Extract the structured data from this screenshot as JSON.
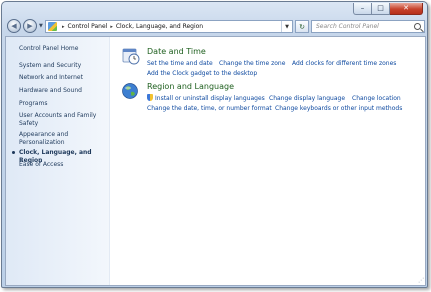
{
  "window": {
    "caption": {
      "minimize": "–",
      "maximize": "□",
      "close": "✕"
    }
  },
  "nav": {
    "back_glyph": "◀",
    "forward_glyph": "▶",
    "dropdown_glyph": "▼",
    "refresh_glyph": "↻"
  },
  "address": {
    "root_glyph": "▸",
    "crumbs": [
      "Control Panel",
      "Clock, Language, and Region"
    ],
    "separator": "▸",
    "dropdown_glyph": "▼"
  },
  "search": {
    "placeholder": "Search Control Panel"
  },
  "sidebar": {
    "home": "Control Panel Home",
    "items": [
      {
        "label": "System and Security"
      },
      {
        "label": "Network and Internet"
      },
      {
        "label": "Hardware and Sound"
      },
      {
        "label": "Programs"
      },
      {
        "label": "User Accounts and Family Safety"
      },
      {
        "label": "Appearance and Personalization"
      },
      {
        "label": "Clock, Language, and Region",
        "current": true
      },
      {
        "label": "Ease of Access"
      }
    ]
  },
  "categories": [
    {
      "title": "Date and Time",
      "icon": "clock-calendar-icon",
      "links": [
        "Set the time and date",
        "Change the time zone",
        "Add clocks for different time zones",
        "Add the Clock gadget to the desktop"
      ]
    },
    {
      "title": "Region and Language",
      "icon": "globe-icon",
      "links": [
        "Install or uninstall display languages",
        "Change display language",
        "Change location",
        "Change the date, time, or number format",
        "Change keyboards or other input methods"
      ]
    }
  ],
  "colors": {
    "link": "#0f4aa0",
    "category_title": "#1e5f1e",
    "sidebar_text": "#1e395b",
    "close_button": "#c7432c"
  }
}
